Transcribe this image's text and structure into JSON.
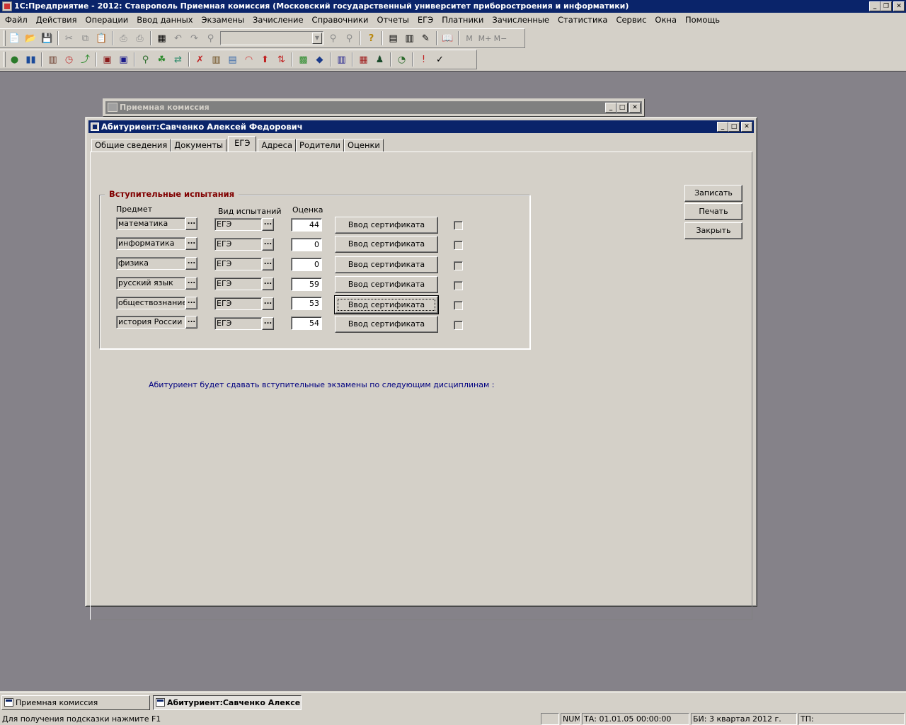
{
  "app": {
    "title": "1С:Предприятие - 2012: Ставрополь Приемная комиссия (Московский государственный университет приборостроения и информатики)"
  },
  "caption_buttons": {
    "minimize": "_",
    "restore": "❐",
    "close": "✕",
    "maximize": "□"
  },
  "menu": [
    "Файл",
    "Действия",
    "Операции",
    "Ввод данных",
    "Экзамены",
    "Зачисление",
    "Справочники",
    "Отчеты",
    "ЕГЭ",
    "Платники",
    "Зачисленные",
    "Статистика",
    "Сервис",
    "Окна",
    "Помощь"
  ],
  "toolbar1": {
    "icons": [
      "new-document-icon",
      "open-folder-icon",
      "save-icon",
      "cut-icon",
      "copy-icon",
      "paste-icon",
      "print-icon",
      "print-preview-icon",
      "filter-icon",
      "undo-icon",
      "redo-icon",
      "find-icon",
      "search-combo",
      "find-next-icon",
      "replace-icon",
      "help-icon",
      "calculator-icon",
      "calendar-icon",
      "pencil-icon",
      "book-icon"
    ],
    "search_value": "",
    "mem_buttons": [
      "M",
      "M+",
      "M−"
    ]
  },
  "window_back": {
    "title": "Приемная комиссия"
  },
  "window_front": {
    "title": "Абитуриент:Савченко Алексей Федорович"
  },
  "tabs": [
    "Общие сведения",
    "Документы",
    "ЕГЭ",
    "Адреса",
    "Родители",
    "Оценки"
  ],
  "active_tab": "ЕГЭ",
  "group": {
    "title": "Вступительные испытания",
    "headers": {
      "subject": "Предмет",
      "type": "Вид испытаний",
      "score": "Оценка"
    },
    "ellipsis": "...",
    "rows": [
      {
        "subject": "математика",
        "type": "ЕГЭ",
        "score": "44",
        "button": "Ввод сертификата",
        "checked": false
      },
      {
        "subject": "информатика",
        "type": "ЕГЭ",
        "score": "0",
        "button": "Ввод сертификата",
        "checked": false
      },
      {
        "subject": "физика",
        "type": "ЕГЭ",
        "score": "0",
        "button": "Ввод сертификата",
        "checked": false
      },
      {
        "subject": "русский язык",
        "type": "ЕГЭ",
        "score": "59",
        "button": "Ввод сертификата",
        "checked": false
      },
      {
        "subject": "обществознание",
        "type": "ЕГЭ",
        "score": "53",
        "button": "Ввод сертификата",
        "checked": false
      },
      {
        "subject": "история России",
        "type": "ЕГЭ",
        "score": "54",
        "button": "Ввод сертификата",
        "checked": false
      }
    ]
  },
  "actions": {
    "save": "Записать",
    "print": "Печать",
    "close": "Закрыть"
  },
  "info_text": "Абитуриент будет сдавать вступительные экзамены по следующим дисциплинам :",
  "mdi_tasks": [
    {
      "label": "Приемная комиссия",
      "active": false
    },
    {
      "label": "Абитуриент:Савченко Алексей...",
      "active": true
    }
  ],
  "status": {
    "hint": "Для получения подсказки нажмите F1",
    "num": "NUM",
    "ta": "ТА: 01.01.05  00:00:00",
    "bi": "БИ: 3 квартал 2012 г.",
    "tp": "ТП:"
  }
}
